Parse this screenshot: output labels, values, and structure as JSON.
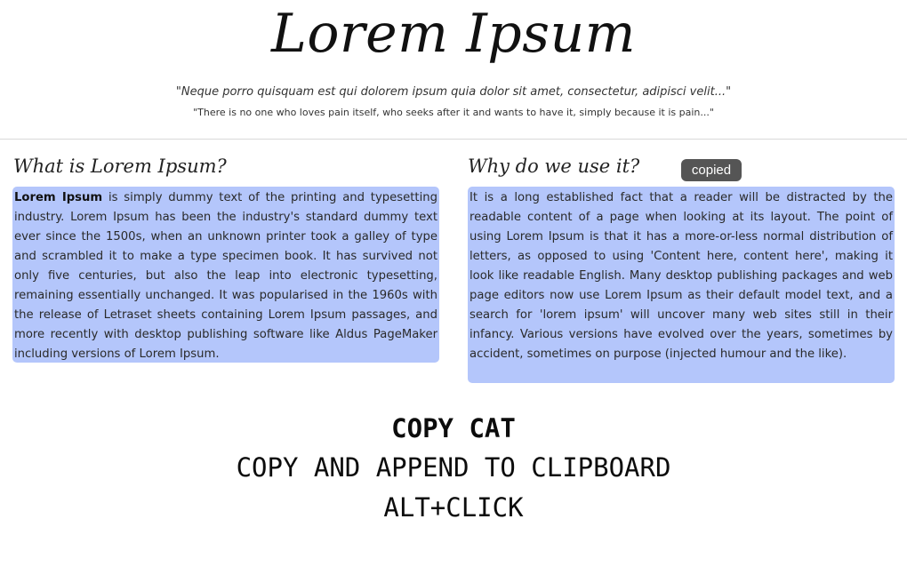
{
  "header": {
    "title": "Lorem Ipsum",
    "quote_latin": "\"Neque porro quisquam est qui dolorem ipsum quia dolor sit amet, consectetur, adipisci velit...\"",
    "quote_english": "\"There is no one who loves pain itself, who seeks after it and wants to have it, simply because it is pain...\""
  },
  "left_column": {
    "heading": "What is Lorem Ipsum?",
    "lead_bold": "Lorem Ipsum",
    "body": " is simply dummy text of the printing and typesetting industry. Lorem Ipsum has been the industry's standard dummy text ever since the 1500s, when an unknown printer took a galley of type and scrambled it to make a type specimen book. It has survived not only five centuries, but also the leap into electronic typesetting, remaining essentially unchanged. It was popularised in the 1960s with the release of Letraset sheets containing Lorem Ipsum passages, and more recently with desktop publishing software like Aldus PageMaker including versions of Lorem Ipsum."
  },
  "right_column": {
    "heading": "Why do we use it?",
    "badge": "copied",
    "body": "It is a long established fact that a reader will be distracted by the readable content of a page when looking at its layout. The point of using Lorem Ipsum is that it has a more-or-less normal distribution of letters, as opposed to using 'Content here, content here', making it look like readable English. Many desktop publishing packages and web page editors now use Lorem Ipsum as their default model text, and a search for 'lorem ipsum' will uncover many web sites still in their infancy. Various versions have evolved over the years, sometimes by accident, sometimes on purpose (injected humour and the like)."
  },
  "footer": {
    "title": "COPY CAT",
    "subtitle": "COPY AND APPEND TO CLIPBOARD",
    "shortcut": "ALT+CLICK"
  },
  "colors": {
    "selection_highlight": "#b4c6fb",
    "badge_background": "#555555"
  }
}
